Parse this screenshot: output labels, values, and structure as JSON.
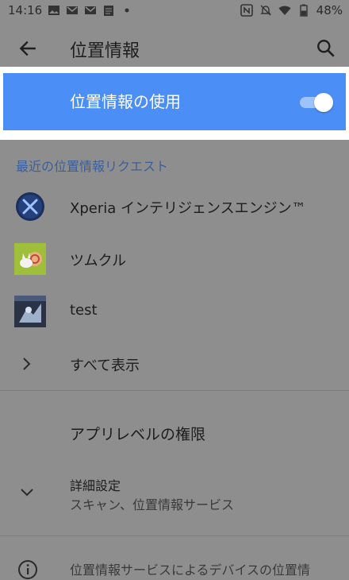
{
  "status_bar": {
    "time": "14:16",
    "battery": "48%",
    "left_icons": [
      "image-icon",
      "gmail-icon",
      "gmail-icon",
      "clipboard-icon",
      "dot-icon"
    ],
    "right_icons": [
      "nfc-icon",
      "notifications-off-icon",
      "wifi-icon",
      "battery-icon"
    ]
  },
  "appbar": {
    "title": "位置情報",
    "back_icon": "arrow-left-icon",
    "search_icon": "search-icon"
  },
  "master_toggle": {
    "label": "位置情報の使用",
    "state": "on",
    "accent": "#4b8ef6"
  },
  "recent_requests": {
    "header": "最近の位置情報リクエスト",
    "apps": [
      {
        "name": "Xperia インテリジェンスエンジン™",
        "icon": "xperia-engine-icon"
      },
      {
        "name": "ツムクル",
        "icon": "tsumkuru-icon"
      },
      {
        "name": "test",
        "icon": "test-app-icon"
      }
    ],
    "show_all": "すべて表示"
  },
  "app_level_permissions": "アプリレベルの権限",
  "advanced": {
    "title": "詳細設定",
    "subtitle": "スキャン、位置情報サービス"
  },
  "footer": {
    "text": "位置情報サービスによるデバイスの位置情",
    "icon": "info-icon"
  }
}
